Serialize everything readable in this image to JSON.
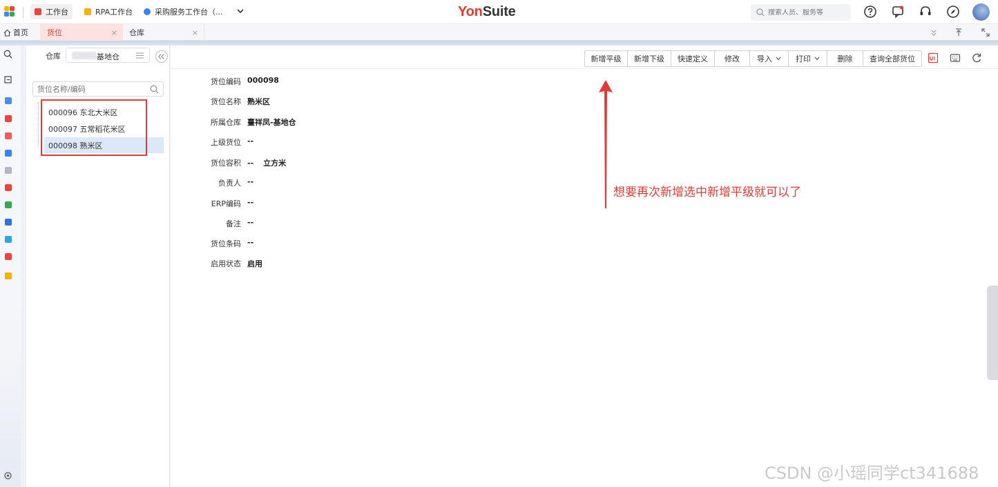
{
  "topbar": {
    "tabs": [
      {
        "label": "工作台",
        "color": "#e8453c"
      },
      {
        "label": "RPA工作台",
        "color": "#f6b400"
      },
      {
        "label": "采购服务工作台（...",
        "color": "#3b82f6"
      }
    ],
    "logo_part1": "Yon",
    "logo_part2": "Suite",
    "search_placeholder": "搜索人员、服务等"
  },
  "page_tabs": {
    "home": "首页",
    "tab1": "货位",
    "tab2": "仓库",
    "close": "×"
  },
  "tree": {
    "warehouse_label": "仓库",
    "warehouse_value": "基地仓",
    "search_placeholder": "货位名称/编码",
    "items": [
      {
        "label": "000096 东北大米区"
      },
      {
        "label": "000097 五常稻花米区"
      },
      {
        "label": "000098 熟米区"
      }
    ]
  },
  "toolbar": {
    "buttons": [
      "新增平级",
      "新增下级",
      "快速定义",
      "修改",
      "导入",
      "打印",
      "删除",
      "查询全部货位"
    ]
  },
  "detail": {
    "fields": [
      {
        "label": "货位编码",
        "value": "000098"
      },
      {
        "label": "货位名称",
        "value": "熟米区"
      },
      {
        "label": "所属仓库",
        "value": "臺祥凤-基地仓"
      },
      {
        "label": "上级货位",
        "value": "--"
      },
      {
        "label": "货位容积",
        "value": "--",
        "unit": "立方米"
      },
      {
        "label": "负责人",
        "value": "--"
      },
      {
        "label": "ERP编码",
        "value": "--"
      },
      {
        "label": "备注",
        "value": "--"
      },
      {
        "label": "货位条码",
        "value": "--"
      },
      {
        "label": "启用状态",
        "value": "启用"
      }
    ]
  },
  "annotation": "想要再次新增选中新增平级就可以了",
  "watermark": "CSDN @小瑶同学ct341688",
  "colors": {
    "brand_red": "#e23c2e",
    "annotation_red": "#e53935",
    "selected_bg": "#dbe8f8"
  }
}
